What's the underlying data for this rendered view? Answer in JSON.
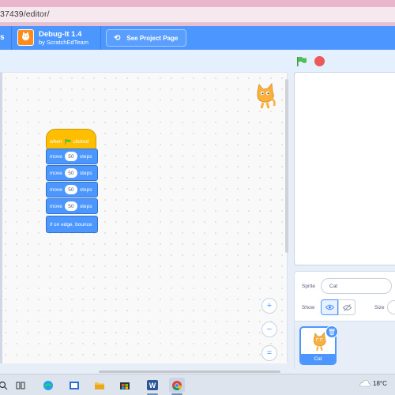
{
  "browser": {
    "url": "37439/editor/"
  },
  "menubar": {
    "partial_label": "s",
    "project_title": "Debug-It 1.4",
    "project_author": "by ScratchEdTeam",
    "see_project_label": "See Project Page"
  },
  "stage_controls": {
    "green_flag": "green-flag-icon",
    "stop": "stop-icon"
  },
  "script": {
    "hat": {
      "when": "when",
      "clicked": "clicked"
    },
    "blocks": [
      {
        "text": "move",
        "value": "50",
        "unit": "steps"
      },
      {
        "text": "move",
        "value": "50",
        "unit": "steps"
      },
      {
        "text": "move",
        "value": "50",
        "unit": "steps"
      },
      {
        "text": "move",
        "value": "50",
        "unit": "steps"
      }
    ],
    "bounce": "if on edge, bounce"
  },
  "zoom": {
    "zoom_in": "zoom-in-icon",
    "zoom_out": "zoom-out-icon",
    "reset": "reset-zoom-icon"
  },
  "sprite_info": {
    "sprite_label": "Sprite",
    "sprite_name": "Cat",
    "show_label": "Show",
    "size_label": "Size"
  },
  "sprite_list": {
    "selected": "Cat"
  },
  "taskbar": {
    "temperature": "18°C"
  },
  "colors": {
    "scratch_blue": "#4c97ff",
    "events_yellow": "#ffbf00",
    "stop_red": "#ec5959",
    "browser_pink": "#e9b6cc"
  }
}
